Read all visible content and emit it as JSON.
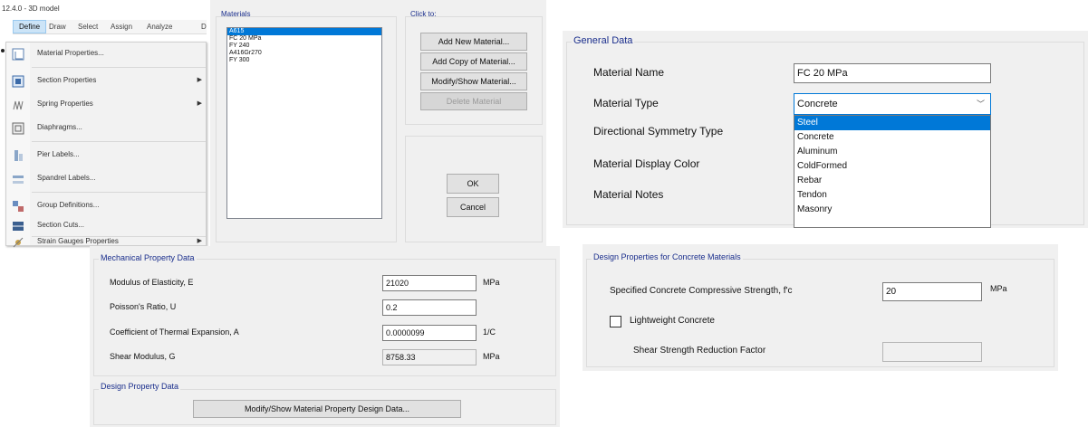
{
  "menu": {
    "title": "12.4.0 - 3D model",
    "bar": [
      "Define",
      "Draw",
      "Select",
      "Assign",
      "Analyze",
      "D"
    ],
    "items": [
      {
        "label": "Material Properties...",
        "icon": "material-icon",
        "arrow": ""
      },
      {
        "label": "Section Properties",
        "icon": "section-icon",
        "arrow": "▶"
      },
      {
        "label": "Spring Properties",
        "icon": "spring-icon",
        "arrow": "▶"
      },
      {
        "label": "Diaphragms...",
        "icon": "diaphragm-icon",
        "arrow": ""
      },
      {
        "label": "Pier Labels...",
        "icon": "pier-icon",
        "arrow": ""
      },
      {
        "label": "Spandrel Labels...",
        "icon": "spandrel-icon",
        "arrow": ""
      },
      {
        "label": "Group Definitions...",
        "icon": "group-icon",
        "arrow": ""
      },
      {
        "label": "Section Cuts...",
        "icon": "section-cut-icon",
        "arrow": ""
      },
      {
        "label": "Strain Gauges Properties",
        "icon": "strain-gauge-icon",
        "arrow": "▶"
      }
    ]
  },
  "materials_dialog": {
    "materials_header": "Materials",
    "click_header": "Click to:",
    "list": [
      "A615",
      "FC 20 MPa",
      "FY 240",
      "A416Gr270",
      "FY 300"
    ],
    "selected_index": 0,
    "buttons": {
      "add_new": "Add New Material...",
      "add_copy": "Add Copy of Material...",
      "modify_show": "Modify/Show Material...",
      "delete": "Delete Material",
      "ok": "OK",
      "cancel": "Cancel"
    }
  },
  "general_data": {
    "header": "General Data",
    "labels": {
      "name": "Material Name",
      "type": "Material Type",
      "symmetry": "Directional Symmetry Type",
      "color": "Material Display Color",
      "notes": "Material Notes"
    },
    "material_name_value": "FC 20 MPa",
    "material_type_value": "Concrete",
    "type_options": [
      "Steel",
      "Concrete",
      "Aluminum",
      "ColdFormed",
      "Rebar",
      "Tendon",
      "Masonry"
    ],
    "highlighted_option": 0,
    "accent": "#0078d7"
  },
  "mechanical": {
    "header": "Mechanical Property Data",
    "rows": [
      {
        "label": "Modulus of Elasticity,  E",
        "value": "21020",
        "unit": "MPa",
        "editable": true
      },
      {
        "label": "Poisson's Ratio,  U",
        "value": "0.2",
        "unit": "",
        "editable": true
      },
      {
        "label": "Coefficient of Thermal Expansion,  A",
        "value": "0.0000099",
        "unit": "1/C",
        "editable": true
      },
      {
        "label": "Shear Modulus,  G",
        "value": "8758.33",
        "unit": "MPa",
        "editable": false
      }
    ],
    "design_header": "Design Property Data",
    "design_button": "Modify/Show Material Property Design Data..."
  },
  "concrete_design": {
    "header": "Design Properties for Concrete Materials",
    "fc_label": "Specified Concrete Compressive Strength, f'c",
    "fc_value": "20",
    "fc_unit": "MPa",
    "lightweight_label": "Lightweight Concrete",
    "lightweight_checked": false,
    "shear_label": "Shear Strength Reduction Factor",
    "shear_value": ""
  }
}
